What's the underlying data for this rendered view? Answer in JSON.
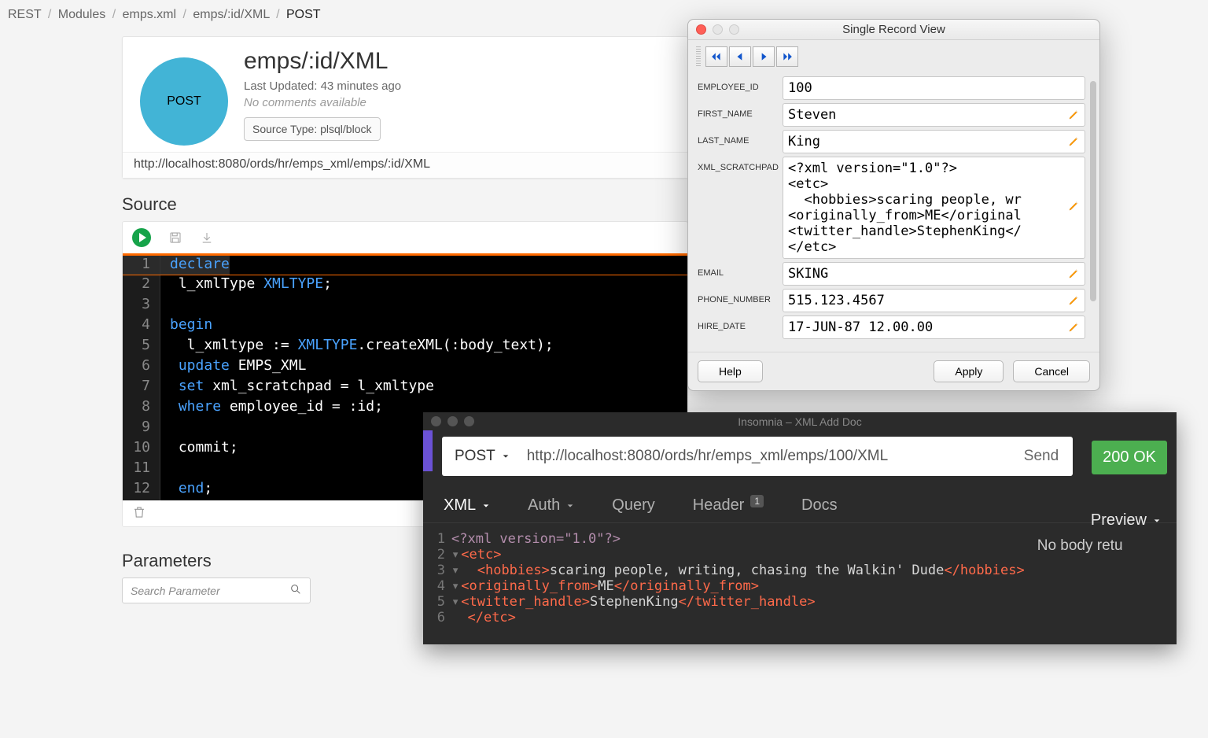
{
  "breadcrumb": {
    "items": [
      "REST",
      "Modules",
      "emps.xml",
      "emps/:id/XML"
    ],
    "current": "POST"
  },
  "header": {
    "method": "POST",
    "title": "emps/:id/XML",
    "lastUpdated": "Last Updated: 43 minutes ago",
    "noComments": "No comments available",
    "sourceType": "Source Type: plsql/block",
    "url": "http://localhost:8080/ords/hr/emps_xml/emps/:id/XML"
  },
  "sections": {
    "source": "Source",
    "parameters": "Parameters"
  },
  "searchPlaceholder": "Search Parameter",
  "sourceCode": {
    "l1": "declare",
    "l2a": " l_xmlType ",
    "l2b": "XMLTYPE",
    "l2c": ";",
    "l4": "begin",
    "l5a": "  l_xmltype := ",
    "l5b": "XMLTYPE",
    "l5c": ".createXML(:body_text);",
    "l6a": " ",
    "l6b": "update",
    "l6c": " EMPS_XML",
    "l7a": " ",
    "l7b": "set",
    "l7c": " xml_scratchpad = l_xmltype",
    "l8a": " ",
    "l8b": "where",
    "l8c": " employee_id = :id;",
    "l10": " commit;",
    "l12a": " ",
    "l12b": "end",
    "l12c": ";"
  },
  "recordView": {
    "title": "Single Record View",
    "fields": {
      "EMPLOYEE_ID": {
        "label": "EMPLOYEE_ID",
        "value": "100"
      },
      "FIRST_NAME": {
        "label": "FIRST_NAME",
        "value": "Steven"
      },
      "LAST_NAME": {
        "label": "LAST_NAME",
        "value": "King"
      },
      "XML_SCRATCHPAD": {
        "label": "XML_SCRATCHPAD",
        "value": "<?xml version=\"1.0\"?>\n<etc>\n  <hobbies>scaring people, wr\n<originally_from>ME</original\n<twitter_handle>StephenKing</\n</etc>"
      },
      "EMAIL": {
        "label": "EMAIL",
        "value": "SKING"
      },
      "PHONE_NUMBER": {
        "label": "PHONE_NUMBER",
        "value": "515.123.4567"
      },
      "HIRE_DATE": {
        "label": "HIRE_DATE",
        "value": "17-JUN-87 12.00.00"
      }
    },
    "buttons": {
      "help": "Help",
      "apply": "Apply",
      "cancel": "Cancel"
    }
  },
  "insomnia": {
    "title": "Insomnia – XML Add Doc",
    "method": "POST",
    "url": "http://localhost:8080/ords/hr/emps_xml/emps/100/XML",
    "send": "Send",
    "status": "200 OK",
    "tabs": {
      "xml": "XML",
      "auth": "Auth",
      "query": "Query",
      "header": "Header",
      "headerBadge": "1",
      "docs": "Docs",
      "preview": "Preview"
    },
    "body": {
      "l1": "<?xml version=\"1.0\"?>",
      "l2o": "<etc>",
      "l3o": "<hobbies>",
      "l3t": "scaring people, writing, chasing the Walkin' Dude",
      "l3c": "</hobbies>",
      "l4o": "<originally_from>",
      "l4t": "ME",
      "l4c": "</originally_from>",
      "l5o": "<twitter_handle>",
      "l5t": "StephenKing",
      "l5c": "</twitter_handle>",
      "l6c": "</etc>"
    },
    "respText": "No body retu"
  }
}
